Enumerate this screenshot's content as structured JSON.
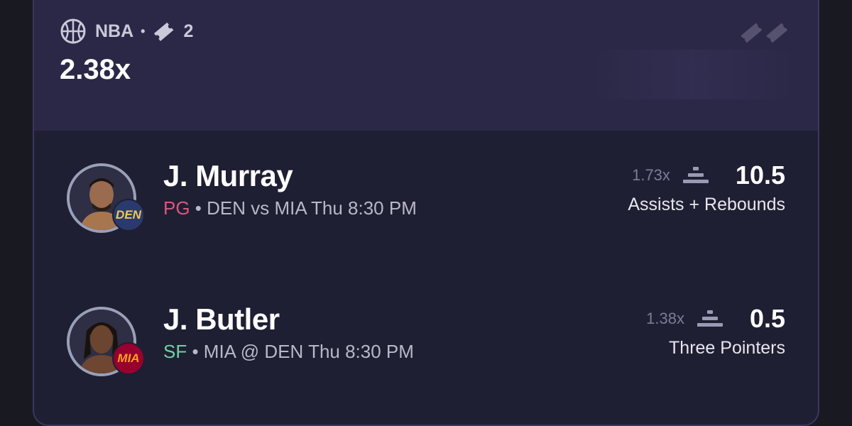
{
  "header": {
    "league": "NBA",
    "league_icon": "basketball-icon",
    "ticket_icon": "ticket-icon",
    "ticket_count": "2",
    "multiplier": "2.38x",
    "top_right_icon": "tickets-icon"
  },
  "picks": [
    {
      "name": "J. Murray",
      "position": "PG",
      "matchup": " • DEN vs MIA Thu 8:30 PM",
      "team": "DEN",
      "odds": "1.73x",
      "line": "10.5",
      "stat": "Assists + Rebounds"
    },
    {
      "name": "J. Butler",
      "position": "SF",
      "matchup": " • MIA @ DEN Thu 8:30 PM",
      "team": "MIA",
      "odds": "1.38x",
      "line": "0.5",
      "stat": "Three Pointers"
    }
  ],
  "colors": {
    "background": "#191921",
    "card": "#1f1f33",
    "header": "#2b2847",
    "position_pg": "#d9587b",
    "position_sf": "#6fd3a3"
  }
}
